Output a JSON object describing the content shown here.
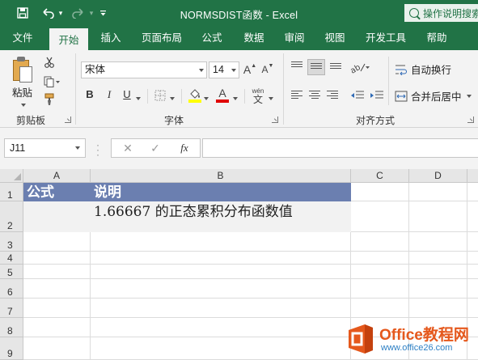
{
  "window": {
    "title": "NORMSDIST函数  -  Excel",
    "tell_me": "操作说明搜索"
  },
  "quick_access": {
    "save_icon": "save-icon",
    "undo_icon": "undo-icon",
    "redo_icon": "redo-icon",
    "customize_icon": "customize-icon"
  },
  "tabs": [
    {
      "label": "文件"
    },
    {
      "label": "开始",
      "active": true
    },
    {
      "label": "插入"
    },
    {
      "label": "页面布局"
    },
    {
      "label": "公式"
    },
    {
      "label": "数据"
    },
    {
      "label": "审阅"
    },
    {
      "label": "视图"
    },
    {
      "label": "开发工具"
    },
    {
      "label": "帮助"
    }
  ],
  "ribbon": {
    "clipboard": {
      "paste_label": "粘贴",
      "group_label": "剪贴板"
    },
    "font": {
      "font_name": "宋体",
      "font_size": "14",
      "bold": "B",
      "italic": "I",
      "underline": "U",
      "font_color_letter": "A",
      "grow_letter": "A",
      "shrink_letter": "A",
      "phonetic_top": "wén",
      "phonetic_bottom": "文",
      "group_label": "字体"
    },
    "alignment": {
      "wrap_text": "自动换行",
      "merge_center": "合并后居中",
      "group_label": "对齐方式"
    }
  },
  "formula_bar": {
    "name_box": "J11",
    "cancel": "✕",
    "enter": "✓",
    "fx": "fx",
    "value": ""
  },
  "sheet": {
    "columns": [
      "A",
      "B",
      "C",
      "D"
    ],
    "rows": [
      "1",
      "2",
      "3",
      "4",
      "5",
      "6",
      "7",
      "8",
      "9"
    ],
    "cells": {
      "A1": "公式",
      "B1": "说明",
      "B2": "1.66667 的正态累积分布函数值"
    }
  },
  "watermark": {
    "title": "Office教程网",
    "url": "www.office26.com"
  },
  "colors": {
    "excel_green": "#217346",
    "header_fill": "#6b7fb0",
    "data_fill": "#f2f2f2"
  }
}
